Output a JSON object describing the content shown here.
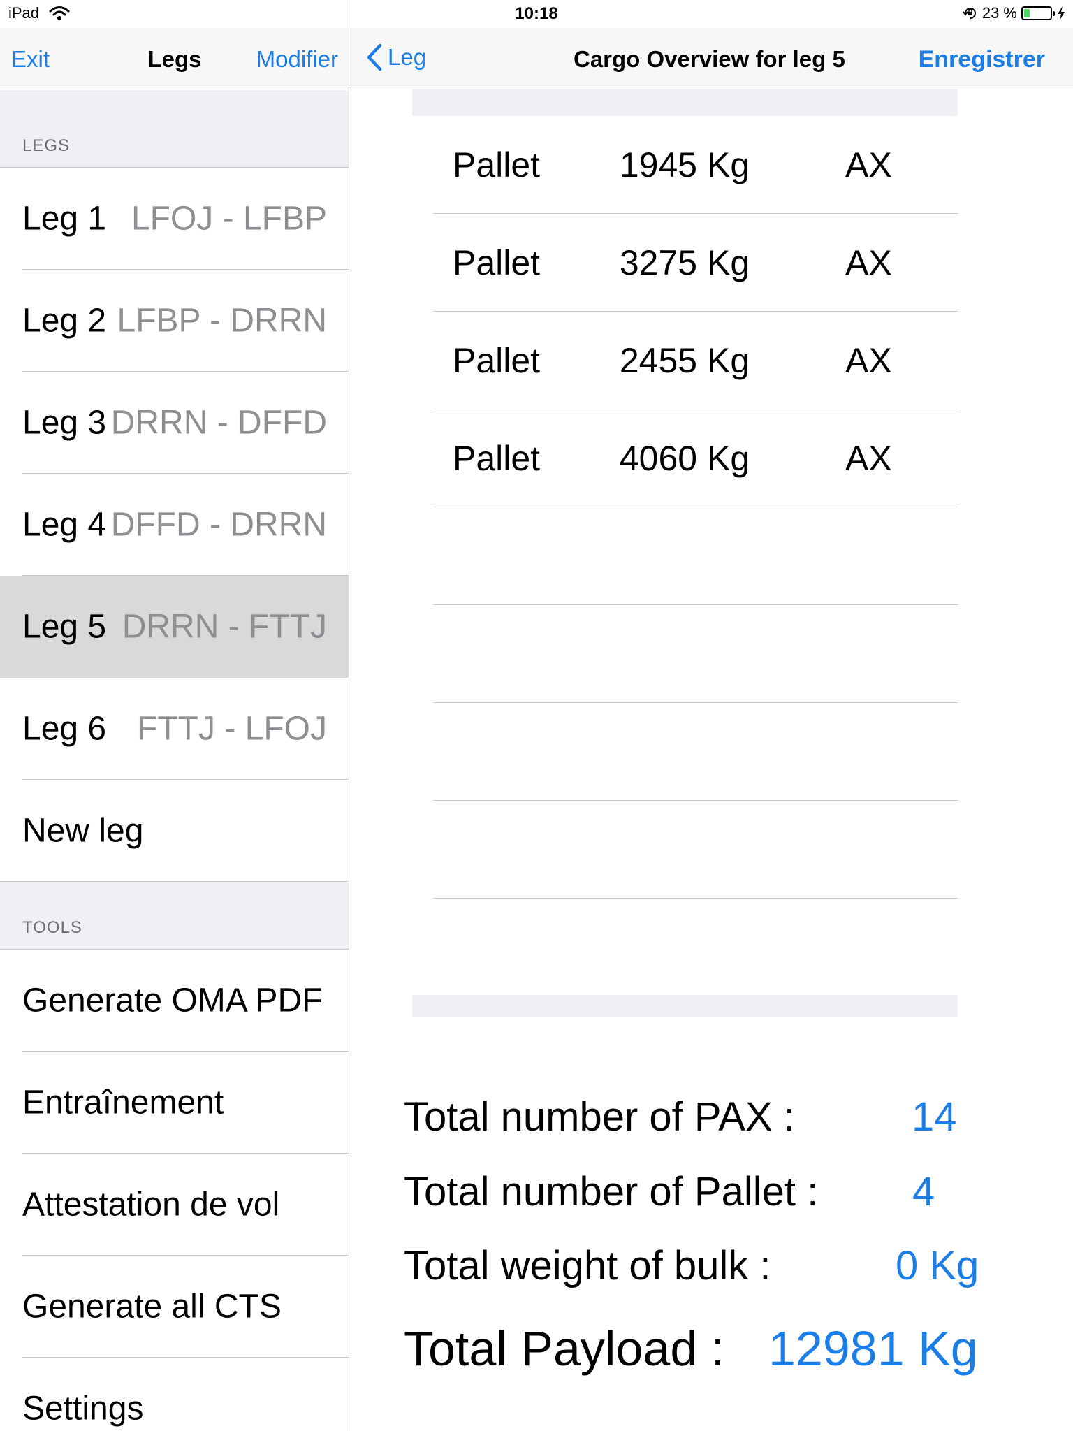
{
  "status_bar": {
    "device": "iPad",
    "time": "10:18",
    "battery_text": "23 %",
    "battery_level": 0.23
  },
  "left_nav": {
    "exit_label": "Exit",
    "title": "Legs",
    "modify_label": "Modifier"
  },
  "legs_section": {
    "header": "LEGS",
    "items": [
      {
        "name": "Leg 1",
        "route": "LFOJ - LFBP"
      },
      {
        "name": "Leg 2",
        "route": "LFBP - DRRN"
      },
      {
        "name": "Leg 3",
        "route": "DRRN - DFFD"
      },
      {
        "name": "Leg 4",
        "route": "DFFD - DRRN"
      },
      {
        "name": "Leg 5",
        "route": "DRRN - FTTJ",
        "selected": true
      },
      {
        "name": "Leg 6",
        "route": "FTTJ - LFOJ"
      }
    ],
    "new_leg_label": "New leg"
  },
  "tools_section": {
    "header": "TOOLS",
    "items": [
      "Generate OMA PDF",
      "Entraînement",
      "Attestation de vol",
      "Generate all CTS",
      "Settings"
    ]
  },
  "right_nav": {
    "back_label": "Leg",
    "title": "Cargo Overview for leg 5",
    "save_label": "Enregistrer"
  },
  "cargo": [
    {
      "type": "Pallet",
      "weight": "1945 Kg",
      "position": "AX"
    },
    {
      "type": "Pallet",
      "weight": "3275 Kg",
      "position": "AX"
    },
    {
      "type": "Pallet",
      "weight": "2455 Kg",
      "position": "AX"
    },
    {
      "type": "Pallet",
      "weight": "4060 Kg",
      "position": "AX"
    }
  ],
  "totals": {
    "pax_label": "Total number of PAX :",
    "pax_value": "14",
    "pallet_label": "Total number of Pallet :",
    "pallet_value": "4",
    "bulk_label": "Total weight of bulk :",
    "bulk_value": "0 Kg",
    "payload_label": "Total Payload :",
    "payload_value": "12981 Kg"
  },
  "colors": {
    "accent": "#1a7ee6",
    "secondary_text": "#8e8e93",
    "group_background": "#efeff4",
    "selected_row": "#d9d9d9",
    "battery": "#4cd964"
  }
}
